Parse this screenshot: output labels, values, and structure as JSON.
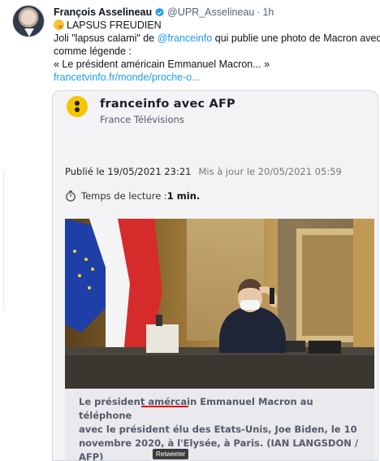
{
  "tweet": {
    "author_name": "François Asselineau",
    "handle": "@UPR_Asselineau",
    "separator": "·",
    "time": "1h",
    "line1_text": "LAPSUS FREUDIEN",
    "line2_prefix": "Joli \"lapsus calami\" de ",
    "line2_mention": "@franceinfo",
    "line2_suffix": " qui publie une photo de Macron avec",
    "line3": "comme légende :",
    "line4": "« Le président américain Emmanuel Macron... »",
    "link": "francetvinfo.fr/monde/proche-o..."
  },
  "article": {
    "source_name": "franceinfo avec AFP",
    "source_sub": "France Télévisions",
    "published": "Publié le 19/05/2021 23:21",
    "updated": "Mis à jour le 20/05/2021 05:59",
    "read_label": "Temps de lecture : ",
    "read_value": "1 min.",
    "caption_line1": "Le président amércain Emmanuel Macron au téléphone",
    "caption_line2": "avec le président élu des Etats-Unis, Joe Biden, le 10",
    "caption_line3": "novembre 2020, à l'Elysée, à Paris. (IAN LANGSDON /",
    "caption_line4": "AFP)"
  },
  "tooltip": "Retweeter",
  "colors": {
    "link": "#1d9bf0",
    "logo": "#f5c500",
    "underline": "#e01616"
  }
}
